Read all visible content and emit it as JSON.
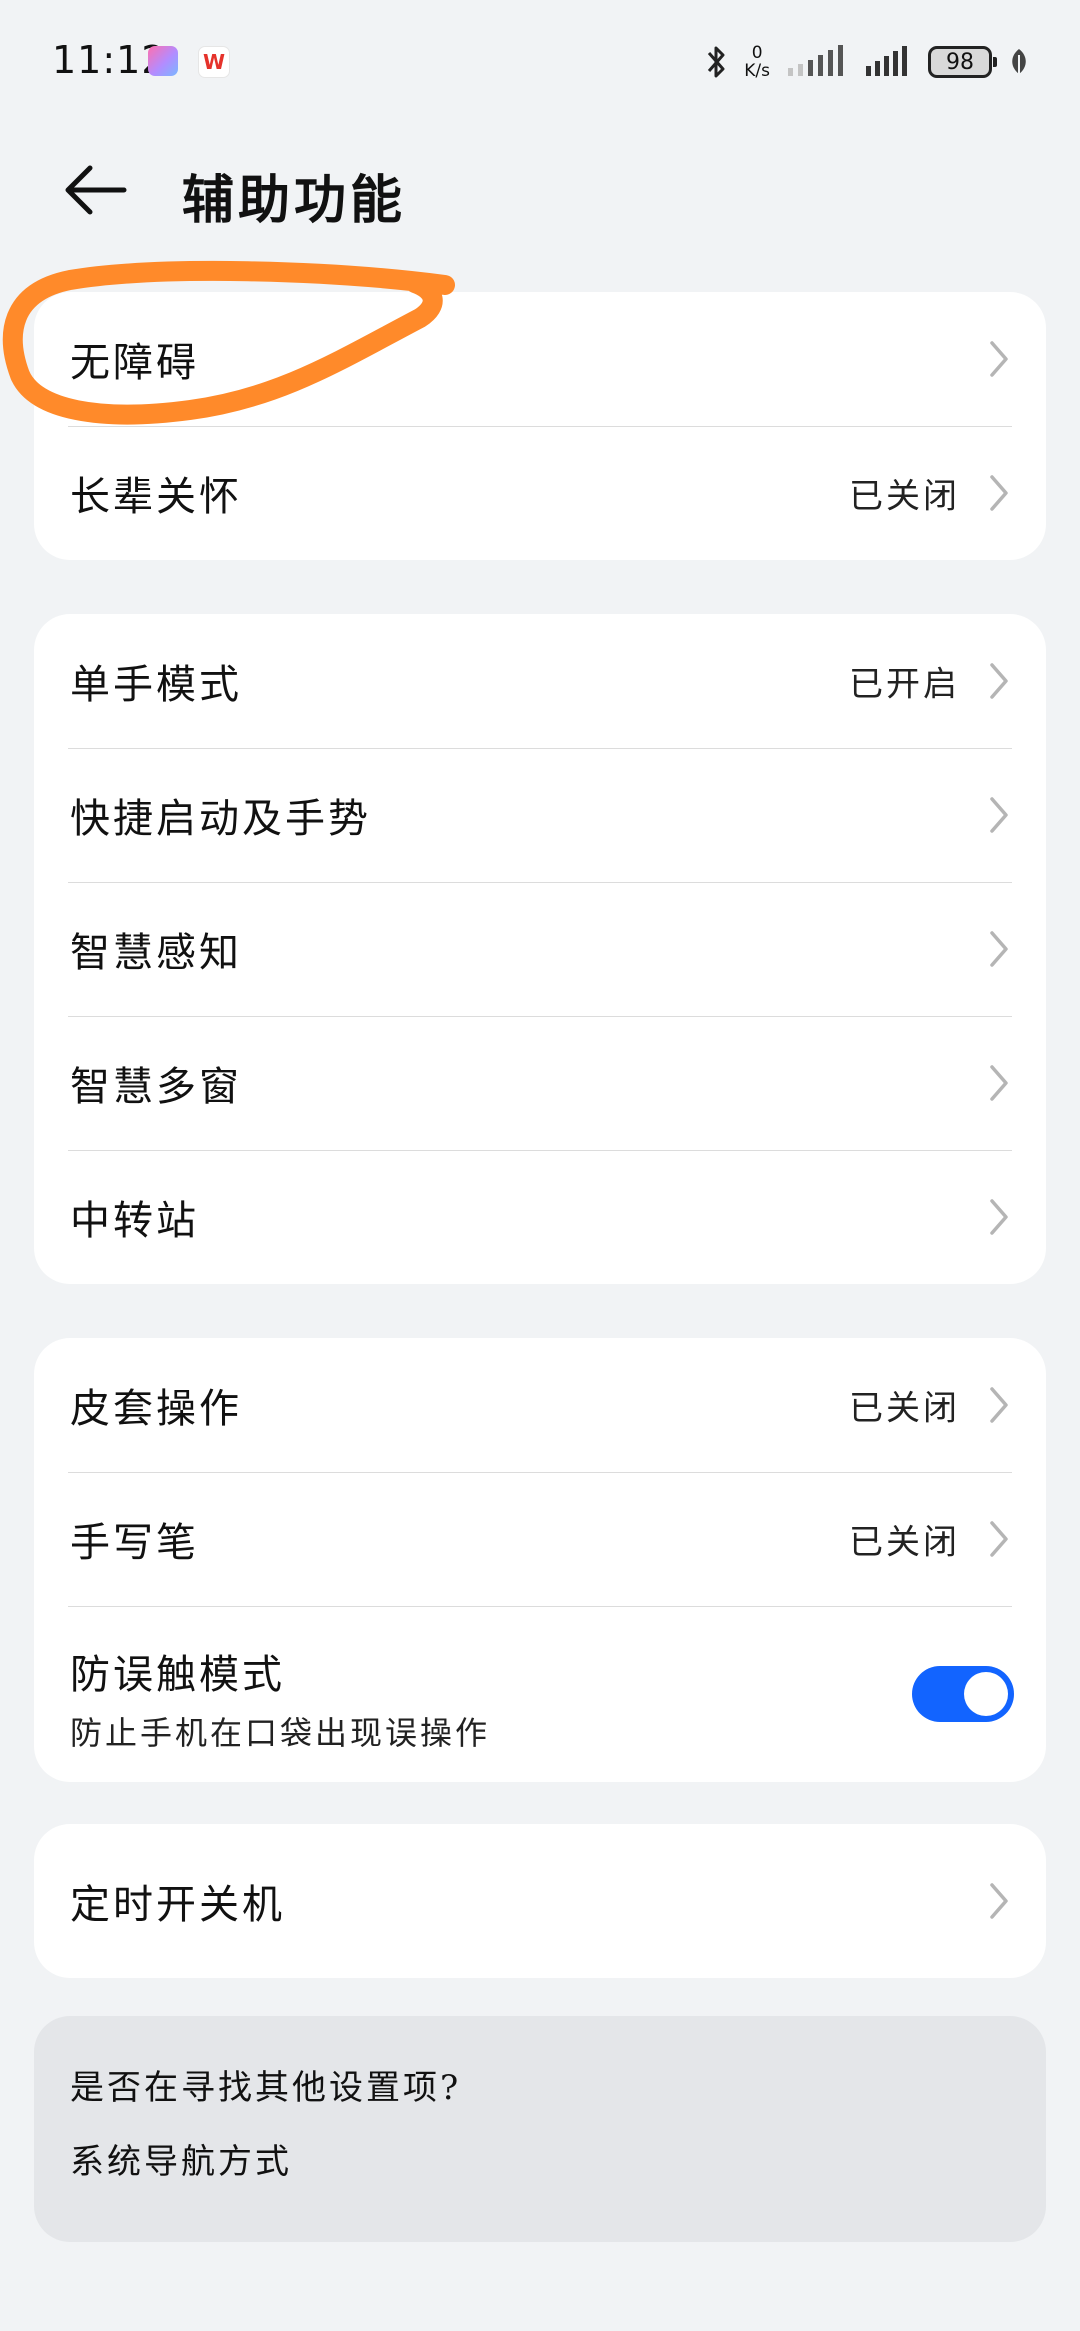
{
  "status_bar": {
    "time": "11:12",
    "net_speed_value": "0",
    "net_speed_unit": "K/s",
    "battery": "98",
    "app_icon_b": "W"
  },
  "header": {
    "title": "辅助功能"
  },
  "groups": [
    {
      "items": [
        {
          "label": "无障碍",
          "value": ""
        },
        {
          "label": "长辈关怀",
          "value": "已关闭"
        }
      ]
    },
    {
      "items": [
        {
          "label": "单手模式",
          "value": "已开启"
        },
        {
          "label": "快捷启动及手势",
          "value": ""
        },
        {
          "label": "智慧感知",
          "value": ""
        },
        {
          "label": "智慧多窗",
          "value": ""
        },
        {
          "label": "中转站",
          "value": ""
        }
      ]
    },
    {
      "items": [
        {
          "label": "皮套操作",
          "value": "已关闭"
        },
        {
          "label": "手写笔",
          "value": "已关闭"
        },
        {
          "label": "防误触模式",
          "subtitle": "防止手机在口袋出现误操作",
          "toggle_on": true
        }
      ]
    },
    {
      "items": [
        {
          "label": "定时开关机",
          "value": ""
        }
      ]
    }
  ],
  "suggestions": {
    "title": "是否在寻找其他设置项?",
    "link": "系统导航方式"
  },
  "colors": {
    "accent": "#1264ff",
    "highlight": "#ff8a2a",
    "background": "#f1f3f5"
  }
}
